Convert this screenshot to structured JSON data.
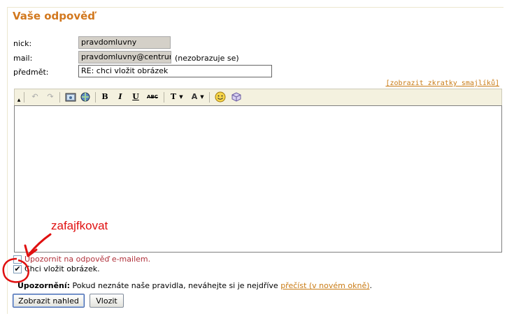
{
  "title": "Vaše odpověď",
  "form": {
    "nick_label": "nick:",
    "nick_value": "pravdomluvny",
    "mail_label": "mail:",
    "mail_value": "pravdomluvny@centrum",
    "mail_note": "(nezobrazuje se)",
    "subject_label": "předmět:",
    "subject_value": "RE: chci vložit obrázek"
  },
  "smiley_link": "[zobrazit zkratky smajlíků]",
  "toolbar": {
    "bold": "B",
    "italic": "I",
    "underline": "U",
    "strike": "ABC",
    "font": "T",
    "color": "A"
  },
  "options": {
    "notify_label": "Upozornit na odpověď e-mailem.",
    "notify_checked": false,
    "image_label": "Chci vložit obrázek.",
    "image_checked": true,
    "checkmark": "✔"
  },
  "warning": {
    "bold": "Upozornění:",
    "text": " Pokud neznáte naše pravidla, neváhejte si je nejdříve ",
    "link": "přečíst (v novém okně)",
    "end": "."
  },
  "buttons": {
    "preview": "Zobrazit nahled",
    "insert": "Vlozit"
  },
  "annotation": "zafajfkovat",
  "colors": {
    "title": "#d2781e",
    "link": "#c97b14",
    "annotation": "#e01010"
  }
}
